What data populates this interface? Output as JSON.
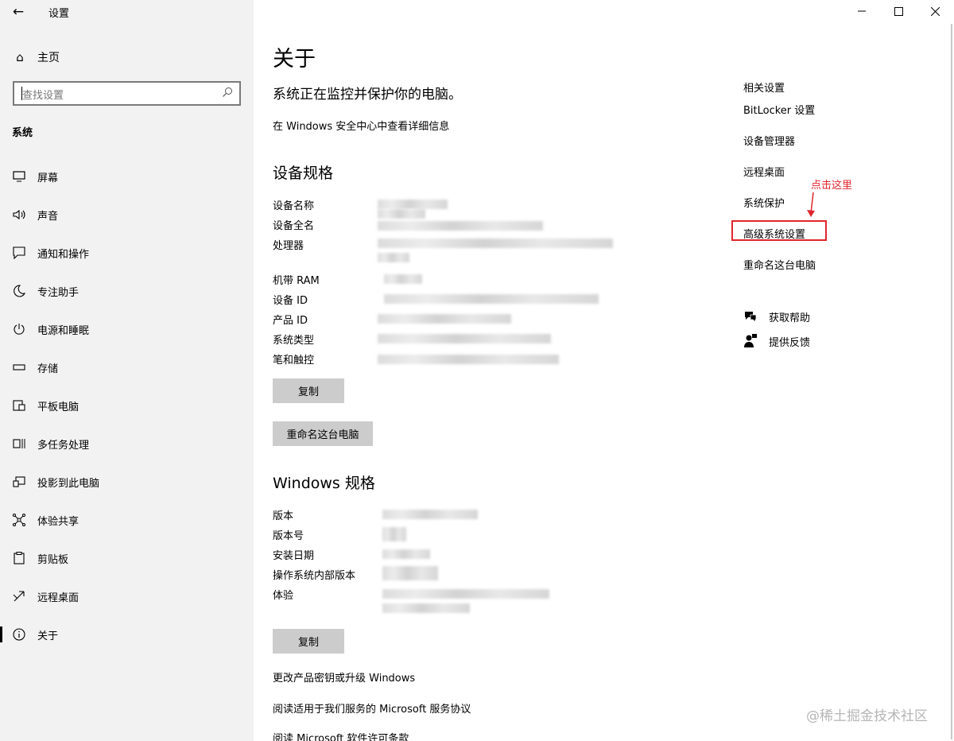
{
  "window": {
    "title": "设置"
  },
  "sidebar": {
    "home_label": "主页",
    "search_placeholder": "查找设置",
    "section": "系统",
    "items": [
      {
        "label": "屏幕",
        "icon": "display-icon"
      },
      {
        "label": "声音",
        "icon": "speaker-icon"
      },
      {
        "label": "通知和操作",
        "icon": "notification-icon"
      },
      {
        "label": "专注助手",
        "icon": "moon-icon"
      },
      {
        "label": "电源和睡眠",
        "icon": "power-icon"
      },
      {
        "label": "存储",
        "icon": "storage-icon"
      },
      {
        "label": "平板电脑",
        "icon": "tablet-icon"
      },
      {
        "label": "多任务处理",
        "icon": "multitask-icon"
      },
      {
        "label": "投影到此电脑",
        "icon": "project-icon"
      },
      {
        "label": "体验共享",
        "icon": "share-icon"
      },
      {
        "label": "剪贴板",
        "icon": "clipboard-icon"
      },
      {
        "label": "远程桌面",
        "icon": "remote-desktop-icon"
      },
      {
        "label": "关于",
        "icon": "info-icon",
        "active": true
      }
    ]
  },
  "main": {
    "title": "关于",
    "status": "系统正在监控并保护你的电脑。",
    "security_link": "在 Windows 安全中心中查看详细信息",
    "device_specs": {
      "heading": "设备规格",
      "rows": [
        "设备名称",
        "设备全名",
        "处理器",
        "机带 RAM",
        "设备 ID",
        "产品 ID",
        "系统类型",
        "笔和触控"
      ],
      "copy_button": "复制",
      "rename_button": "重命名这台电脑"
    },
    "windows_specs": {
      "heading": "Windows 规格",
      "rows": [
        "版本",
        "版本号",
        "安装日期",
        "操作系统内部版本",
        "体验"
      ],
      "copy_button": "复制"
    },
    "links": [
      "更改产品密钥或升级 Windows",
      "阅读适用于我们服务的 Microsoft 服务协议",
      "阅读 Microsoft 软件许可条款"
    ]
  },
  "related": {
    "heading": "相关设置",
    "links": [
      "BitLocker 设置",
      "设备管理器",
      "远程桌面",
      "系统保护",
      "高级系统设置",
      "重命名这台电脑"
    ],
    "annotation": "点击这里",
    "help": "获取帮助",
    "feedback": "提供反馈"
  },
  "watermark": "@稀土掘金技术社区",
  "colors": {
    "annotation": "#e0262d",
    "sidebar_bg": "#f2f2f2",
    "button_bg": "#cccccc"
  }
}
